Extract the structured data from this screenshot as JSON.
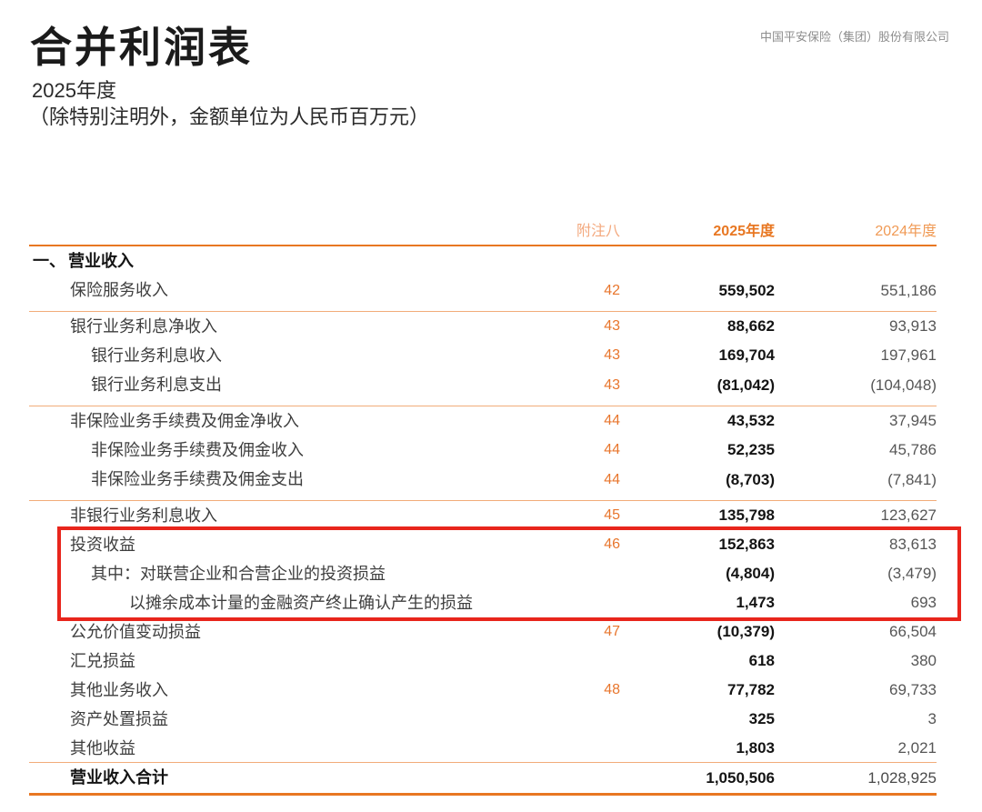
{
  "page": {
    "title": "合并利润表",
    "period": "2025年度",
    "unit_note": "（除特别注明外，金额单位为人民币百万元）",
    "company": "中国平安保险（集团）股份有限公司"
  },
  "colors": {
    "brand_orange": "#E87722",
    "light_orange_rule": "#F2AC79",
    "note_orange": "#E8762D",
    "highlight_red": "#E8251C"
  },
  "table": {
    "header": {
      "note": "附注八",
      "col_2025": "2025年度",
      "col_2024": "2024年度"
    },
    "section": {
      "marker": "一、",
      "label": "营业收入"
    },
    "rows": [
      {
        "label": "保险服务收入",
        "note": "42",
        "v2025": "559,502",
        "v2024": "551,186"
      },
      {
        "label": "银行业务利息净收入",
        "note": "43",
        "v2025": "88,662",
        "v2024": "93,913"
      },
      {
        "label": "银行业务利息收入",
        "note": "43",
        "v2025": "169,704",
        "v2024": "197,961"
      },
      {
        "label": "银行业务利息支出",
        "note": "43",
        "v2025": "(81,042)",
        "v2024": "(104,048)"
      },
      {
        "label": "非保险业务手续费及佣金净收入",
        "note": "44",
        "v2025": "43,532",
        "v2024": "37,945"
      },
      {
        "label": "非保险业务手续费及佣金收入",
        "note": "44",
        "v2025": "52,235",
        "v2024": "45,786"
      },
      {
        "label": "非保险业务手续费及佣金支出",
        "note": "44",
        "v2025": "(8,703)",
        "v2024": "(7,841)"
      },
      {
        "label": "非银行业务利息收入",
        "note": "45",
        "v2025": "135,798",
        "v2024": "123,627"
      },
      {
        "label": "投资收益",
        "note": "46",
        "v2025": "152,863",
        "v2024": "83,613"
      },
      {
        "label": "其中：对联营企业和合营企业的投资损益",
        "v2025": "(4,804)",
        "v2024": "(3,479)"
      },
      {
        "label": "以摊余成本计量的金融资产终止确认产生的损益",
        "v2025": "1,473",
        "v2024": "693"
      },
      {
        "label": "公允价值变动损益",
        "note": "47",
        "v2025": "(10,379)",
        "v2024": "66,504"
      },
      {
        "label": "汇兑损益",
        "v2025": "618",
        "v2024": "380"
      },
      {
        "label": "其他业务收入",
        "note": "48",
        "v2025": "77,782",
        "v2024": "69,733"
      },
      {
        "label": "资产处置损益",
        "v2025": "325",
        "v2024": "3"
      },
      {
        "label": "其他收益",
        "v2025": "1,803",
        "v2024": "2,021"
      },
      {
        "label": "营业收入合计",
        "v2025": "1,050,506",
        "v2024": "1,028,925"
      }
    ]
  }
}
